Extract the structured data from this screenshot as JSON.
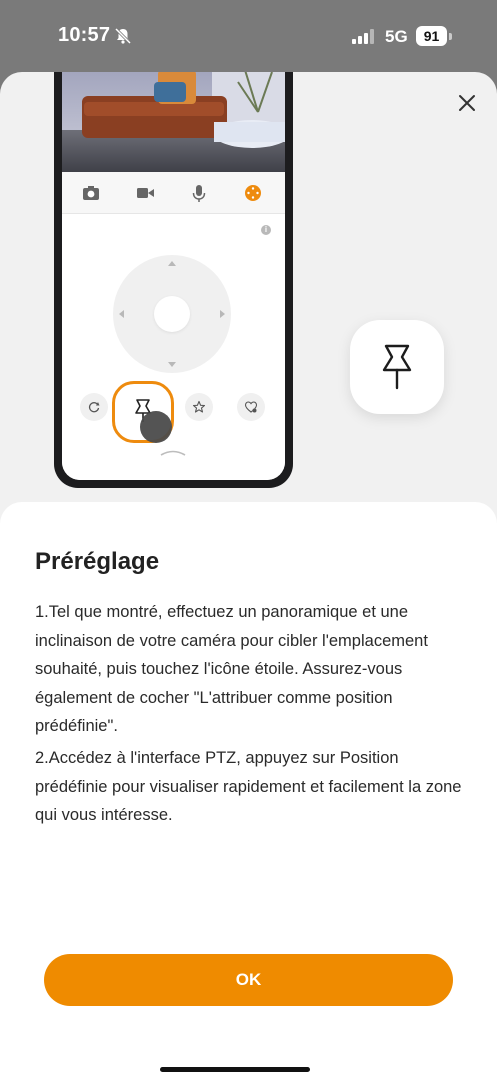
{
  "status_bar": {
    "time": "10:57",
    "network": "5G",
    "battery": "91"
  },
  "sheet": {
    "close_icon": "close-icon"
  },
  "illustration": {
    "toolbar_icons": [
      "camera-icon",
      "video-icon",
      "microphone-icon",
      "ptz-icon"
    ],
    "accent_color": "#ee8b0e",
    "info_label": "i"
  },
  "content": {
    "title": "Préréglage",
    "paragraph1": "1.Tel que montré, effectuez un panoramique et une inclinaison de votre caméra pour cibler l'emplacement souhaité, puis touchez l'icône étoile. Assurez-vous également de cocher \"L'attribuer comme position prédéfinie\".",
    "paragraph2": "2.Accédez à l'interface PTZ, appuyez sur Position prédéfinie pour visualiser rapidement et facilement la zone qui vous intéresse.",
    "ok_label": "OK",
    "button_color": "#ef8b00"
  }
}
